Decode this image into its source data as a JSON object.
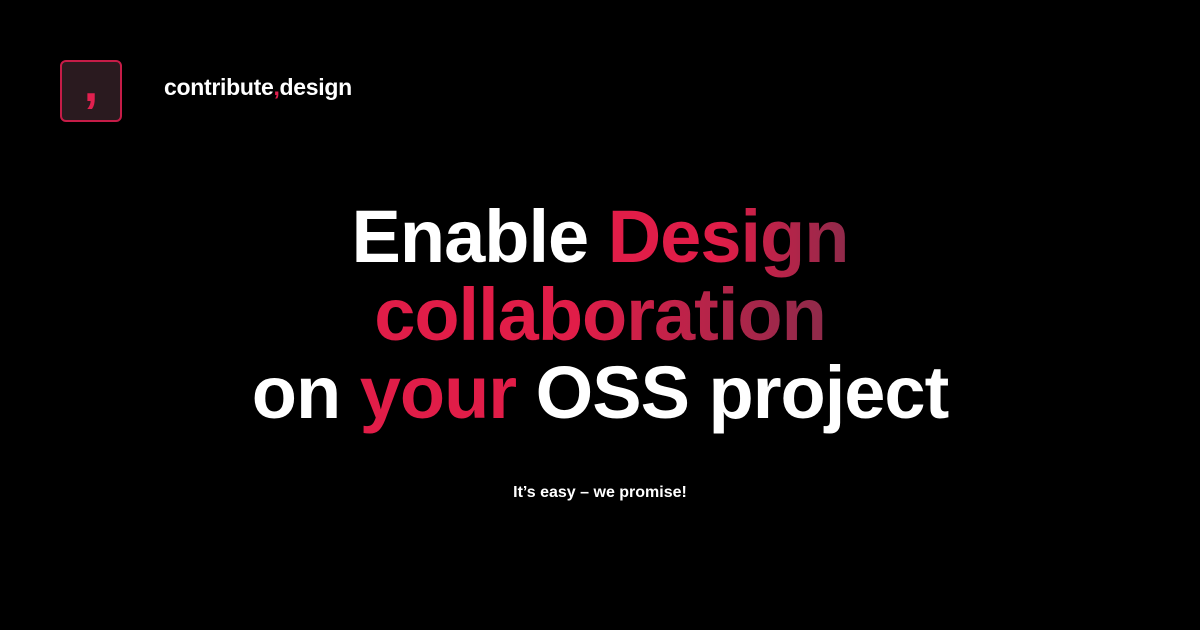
{
  "logo": {
    "glyph": ",",
    "icon": "comma-logo-icon",
    "accent_color": "#e0204f",
    "border_color": "#c51c47",
    "background": "#2a1a1f"
  },
  "brand": {
    "part1": "contribute",
    "separator": ",",
    "part2": "design"
  },
  "headline": {
    "line1": {
      "word1": "Enable ",
      "word2": "Design"
    },
    "line2": {
      "text": "collaboration"
    },
    "line3": {
      "word1": "on ",
      "word2": "your",
      "word3": " OSS project"
    }
  },
  "tagline": "It’s easy – we promise!",
  "colors": {
    "background": "#000000",
    "text": "#ffffff",
    "accent": "#e11d48",
    "accent_dark": "#8f2a4a"
  }
}
